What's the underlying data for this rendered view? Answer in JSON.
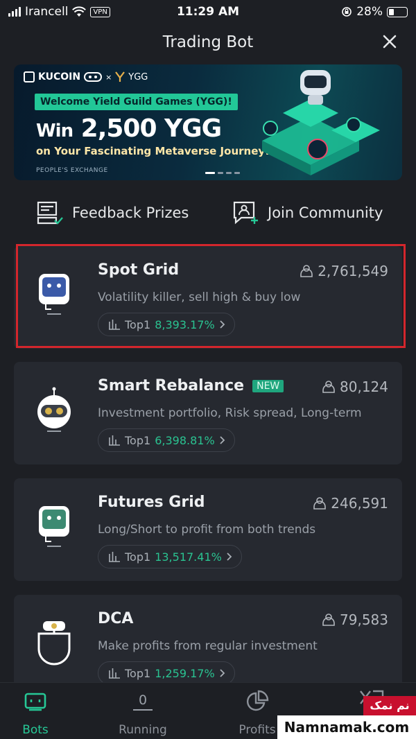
{
  "status_bar": {
    "carrier": "Irancell",
    "vpn": "VPN",
    "time": "11:29 AM",
    "battery": "28%",
    "battery_level": 0.28
  },
  "header": {
    "title": "Trading Bot"
  },
  "banner": {
    "brand": "KUCOIN",
    "partner": "YGG",
    "headline": "Welcome Yield Guild Games (YGG)!",
    "win_prefix": "Win",
    "win_amount": "2,500 YGG",
    "subline": "on Your Fascinating Metaverse Journey!",
    "footer": "PEOPLE'S EXCHANGE"
  },
  "quick_actions": {
    "feedback": "Feedback Prizes",
    "community": "Join Community"
  },
  "bots": [
    {
      "name": "Spot Grid",
      "badge": "",
      "users": "2,761,549",
      "description": "Volatility killer, sell high & buy low",
      "top_label": "Top1",
      "top_value": "8,393.17%"
    },
    {
      "name": "Smart Rebalance",
      "badge": "NEW",
      "users": "80,124",
      "description": "Investment portfolio, Risk spread, Long-term",
      "top_label": "Top1",
      "top_value": "6,398.81%"
    },
    {
      "name": "Futures Grid",
      "badge": "",
      "users": "246,591",
      "description": "Long/Short to profit from both trends",
      "top_label": "Top1",
      "top_value": "13,517.41%"
    },
    {
      "name": "DCA",
      "badge": "",
      "users": "79,583",
      "description": "Make profits from regular investment",
      "top_label": "Top1",
      "top_value": "1,259.17%"
    }
  ],
  "tabs": {
    "bots": "Bots",
    "running": "Running",
    "running_count": "0",
    "profits": "Profits"
  },
  "watermark": {
    "persian": "نم نمک",
    "site": "Namnamak.com"
  },
  "colors": {
    "accent": "#26c896",
    "selection": "#d3262c",
    "background": "#1d1f24",
    "card": "#262930"
  }
}
